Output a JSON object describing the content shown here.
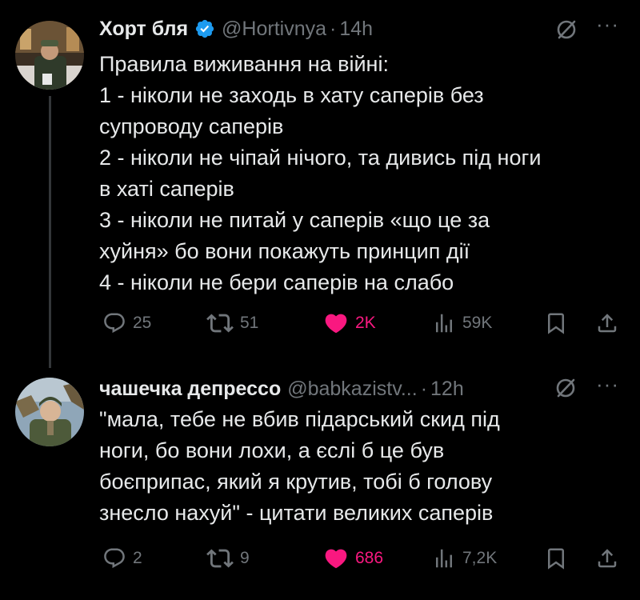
{
  "tweets": [
    {
      "author": {
        "name": "Хорт бля",
        "handle": "@Hortivnya",
        "time": "14h",
        "verified": true
      },
      "lines": [
        "Правила виживання на війні:",
        "1 - ніколи не заходь в хату саперів без",
        "супроводу саперів",
        "2 - ніколи не чіпай нічого, та дивись під ноги",
        "в хаті саперів",
        "3 - ніколи не питай у саперів «що це за",
        "хуйня» бо вони покажуть принцип дії",
        "4 - ніколи не бери саперів на слабо"
      ],
      "stats": {
        "replies": "25",
        "reposts": "51",
        "likes": "2K",
        "views": "59K"
      }
    },
    {
      "author": {
        "name": "чашечка депрессо",
        "handle": "@babkazistv...",
        "time": "12h",
        "verified": false
      },
      "lines": [
        "\"мала, тебе не вбив підарський скид під",
        "ноги, бо вони лохи, а єслі б це був",
        "боєприпас, який я крутив, тобі б голову",
        "знесло нахуй\" - цитати великих саперів"
      ],
      "stats": {
        "replies": "2",
        "reposts": "9",
        "likes": "686",
        "views": "7,2K"
      }
    }
  ],
  "ui": {
    "separator": "·",
    "more": "···"
  },
  "colors": {
    "background": "#000000",
    "text": "#e7e9ea",
    "muted": "#71767b",
    "like": "#f91880",
    "verified": "#1d9bf0"
  },
  "icons": [
    "verified-badge-icon",
    "grok-icon",
    "more-icon",
    "reply-icon",
    "repost-icon",
    "like-icon",
    "views-icon",
    "bookmark-icon",
    "share-icon"
  ]
}
